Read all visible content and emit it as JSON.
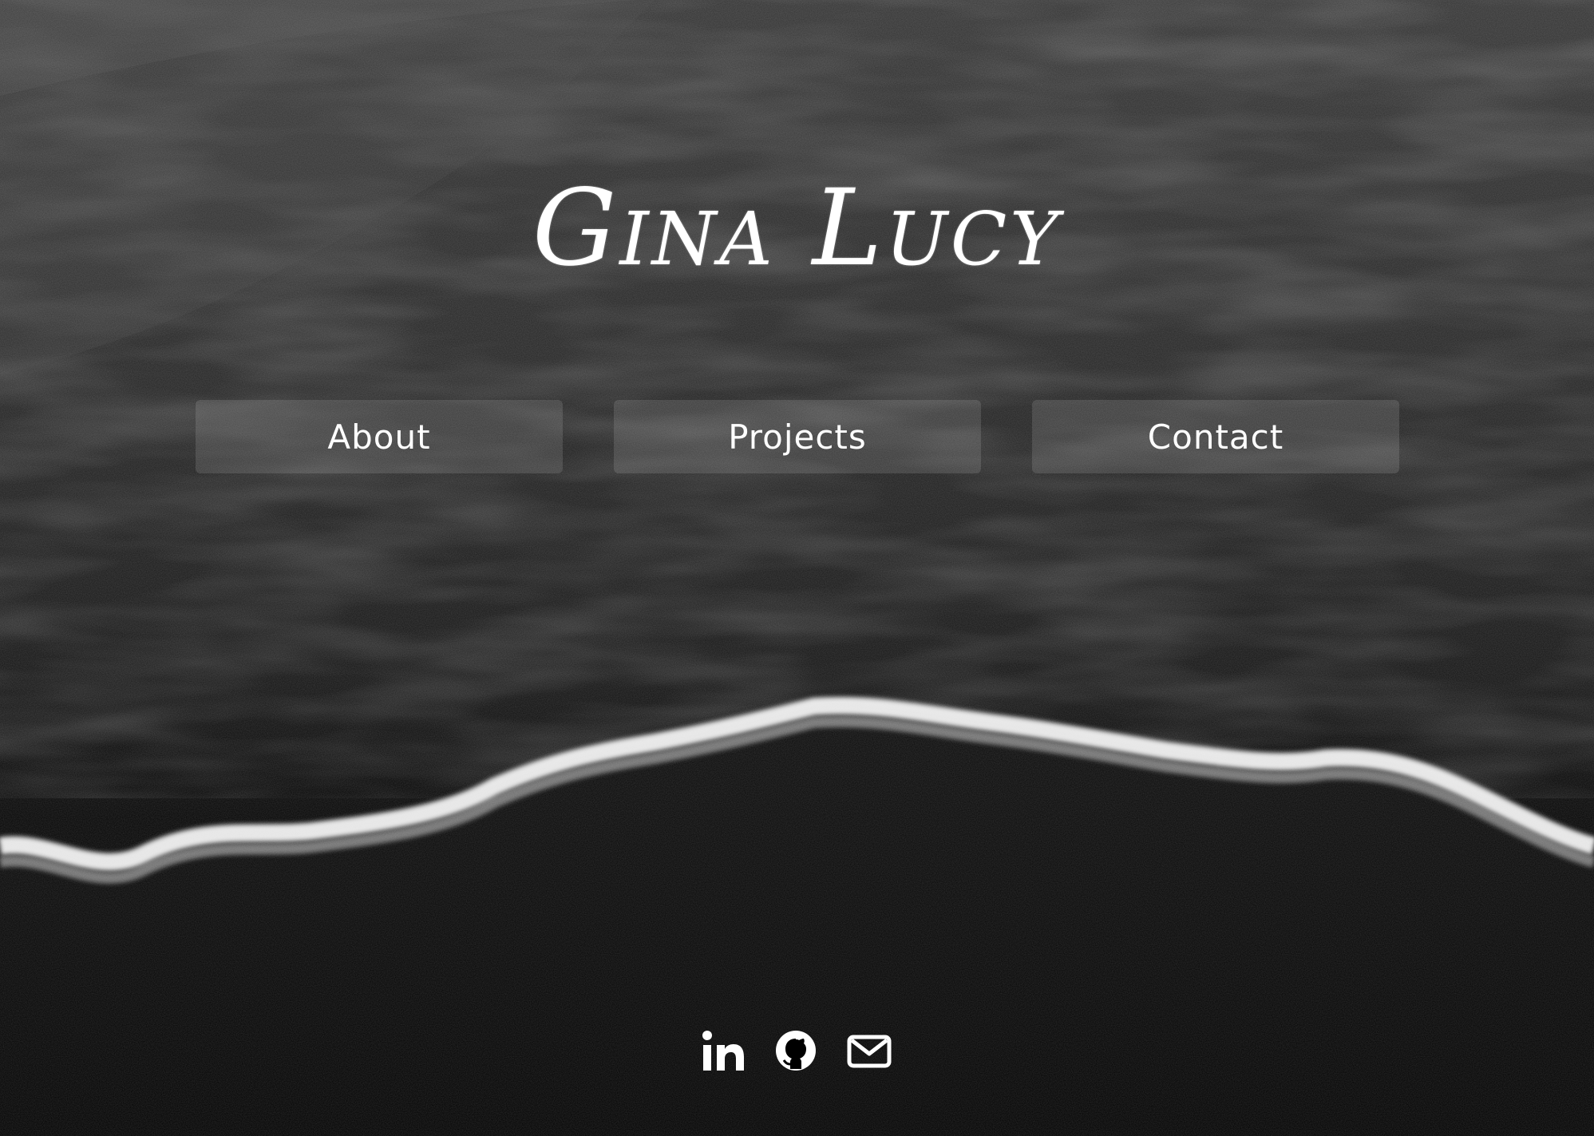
{
  "site": {
    "name": "Gina Lucy"
  },
  "nav": {
    "items": [
      {
        "label": "About"
      },
      {
        "label": "Projects"
      },
      {
        "label": "Contact"
      }
    ]
  },
  "social": {
    "icons": [
      "linkedin-icon",
      "github-icon",
      "mail-icon"
    ]
  },
  "colors": {
    "text": "#ffffff",
    "background": "#000000",
    "button_fill": "rgba(255,255,255,0.12)"
  }
}
